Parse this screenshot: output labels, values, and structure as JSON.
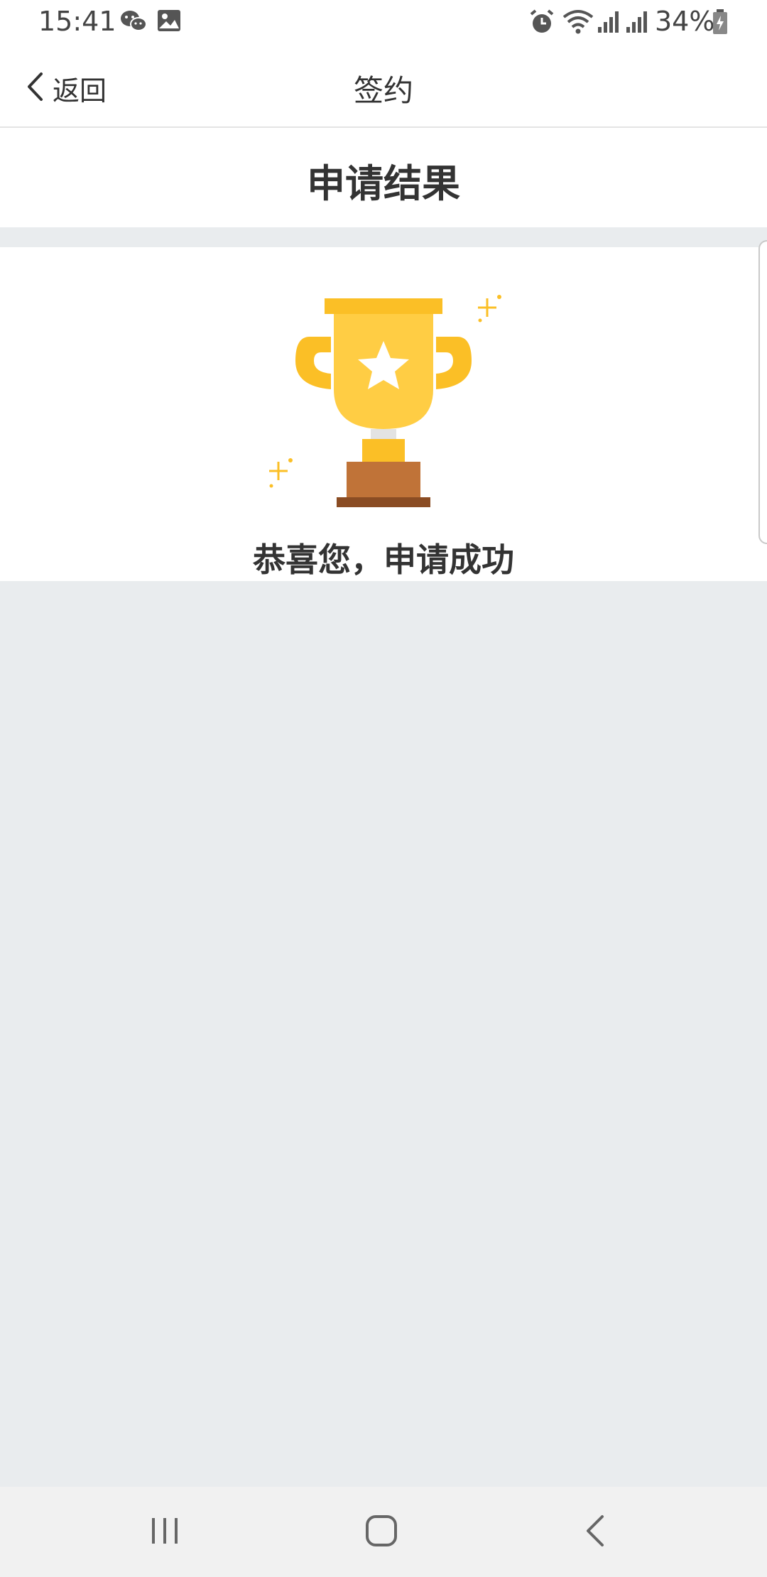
{
  "status_bar": {
    "time": "15:41",
    "battery": "34%",
    "icons": [
      "wechat-icon",
      "gallery-icon",
      "alarm-icon",
      "wifi-icon",
      "signal-icon",
      "signal-icon",
      "battery-charging-icon"
    ]
  },
  "header": {
    "back_label": "返回",
    "title": "签约"
  },
  "result": {
    "title": "申请结果",
    "message": "恭喜您，申请成功",
    "icon": "trophy-icon"
  },
  "bottom_nav": {
    "icons": [
      "recent-apps-icon",
      "home-icon",
      "back-icon"
    ]
  },
  "colors": {
    "trophy_gold": "#fbbf26",
    "trophy_light": "#ffcd44",
    "base_brown": "#c07338",
    "base_dark": "#8a4c23",
    "background": "#e9ecee"
  }
}
